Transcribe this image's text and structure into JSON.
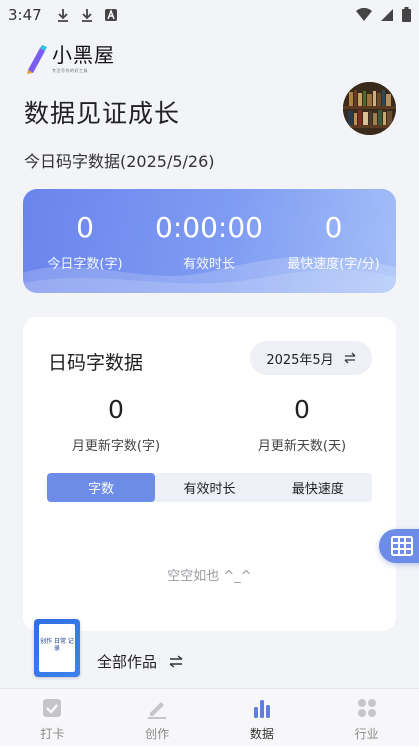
{
  "status": {
    "time": "3:47"
  },
  "app": {
    "logo_text": "小黑屋",
    "logo_tagline": "专注写作的好工具"
  },
  "header": {
    "title": "数据见证成长"
  },
  "today": {
    "subtitle": "今日码字数据(2025/5/26)"
  },
  "stats": [
    {
      "value": "0",
      "label": "今日字数(字)"
    },
    {
      "value": "0:00:00",
      "label": "有效时长"
    },
    {
      "value": "0",
      "label": "最快速度(字/分)"
    }
  ],
  "daily": {
    "title": "日码字数据",
    "month": "2025年5月",
    "month_stats": [
      {
        "value": "0",
        "label": "月更新字数(字)"
      },
      {
        "value": "0",
        "label": "月更新天数(天)"
      }
    ],
    "tabs": [
      "字数",
      "有效时长",
      "最快速度"
    ],
    "active_tab": 0,
    "empty_text": "空空如也 ^_^"
  },
  "works": {
    "label": "全部作品",
    "book_cover_text": "创作 日常 记录"
  },
  "nav": [
    {
      "label": "打卡",
      "icon": "check-square-icon"
    },
    {
      "label": "创作",
      "icon": "pen-icon"
    },
    {
      "label": "数据",
      "icon": "bar-chart-icon"
    },
    {
      "label": "行业",
      "icon": "grid-icon"
    }
  ],
  "colors": {
    "accent": "#6d8ce8",
    "card_gradient_start": "#6a84ec",
    "card_gradient_end": "#a4bff8"
  }
}
